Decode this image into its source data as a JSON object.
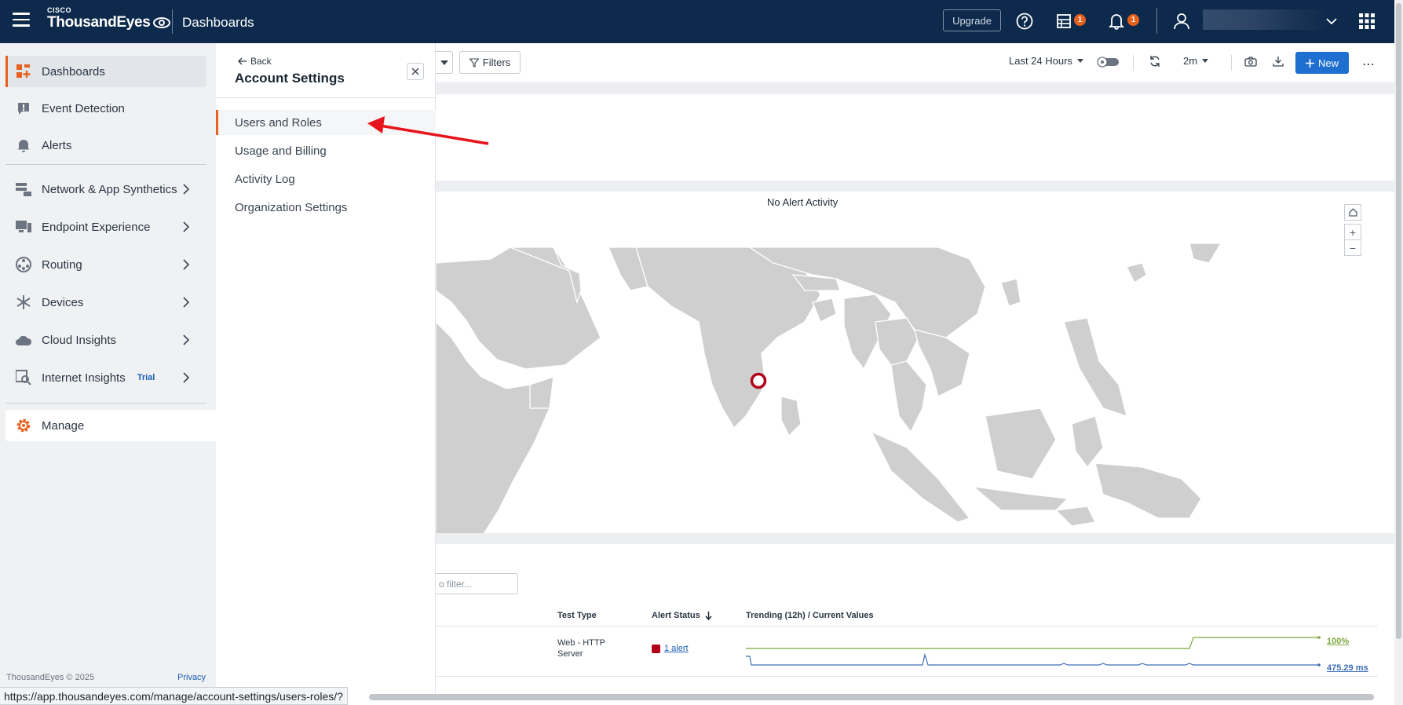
{
  "header": {
    "brand_small": "CISCO",
    "brand_name": "ThousandEyes",
    "app_title": "Dashboards",
    "upgrade_label": "Upgrade",
    "reports_badge": "1",
    "notifications_badge": "1"
  },
  "sidebar": {
    "items": [
      {
        "label": "Dashboards",
        "icon": "dashboards-icon"
      },
      {
        "label": "Event Detection",
        "icon": "event-detection-icon"
      },
      {
        "label": "Alerts",
        "icon": "bell-icon"
      },
      {
        "label": "Network & App Synthetics",
        "icon": "network-icon"
      },
      {
        "label": "Endpoint Experience",
        "icon": "endpoint-icon"
      },
      {
        "label": "Routing",
        "icon": "routing-icon"
      },
      {
        "label": "Devices",
        "icon": "devices-icon"
      },
      {
        "label": "Cloud Insights",
        "icon": "cloud-icon"
      },
      {
        "label": "Internet Insights",
        "icon": "internet-insights-icon",
        "tag": "Trial"
      },
      {
        "label": "Manage",
        "icon": "gear-icon"
      }
    ],
    "footer_copyright": "ThousandEyes © 2025",
    "footer_privacy": "Privacy"
  },
  "panel": {
    "back_label": "Back",
    "title": "Account Settings",
    "items": [
      "Users and Roles",
      "Usage and Billing",
      "Activity Log",
      "Organization Settings"
    ]
  },
  "toolbar": {
    "filters_label": "Filters",
    "time_range": "Last 24 Hours",
    "refresh_interval": "2m",
    "new_label": "New"
  },
  "alerts_widget": {
    "message": "No Alert Activity"
  },
  "table": {
    "filter_placeholder": "o filter...",
    "headers": [
      "Test Type",
      "Alert Status",
      "Trending (12h) / Current Values"
    ],
    "row": {
      "test_type_line1": "Web - HTTP",
      "test_type_line2": "Server",
      "alert_status": "1 alert",
      "value_availability": "100%",
      "value_response": "475.29 ms"
    }
  },
  "status_bar": {
    "url": "https://app.thousandeyes.com/manage/account-settings/users-roles/?"
  },
  "colors": {
    "header_bg": "#0d2a4c",
    "accent_orange": "#e8601c",
    "primary_blue": "#1e6fd0",
    "alert_red": "#b3001b",
    "availability_green": "#7ba83c"
  }
}
